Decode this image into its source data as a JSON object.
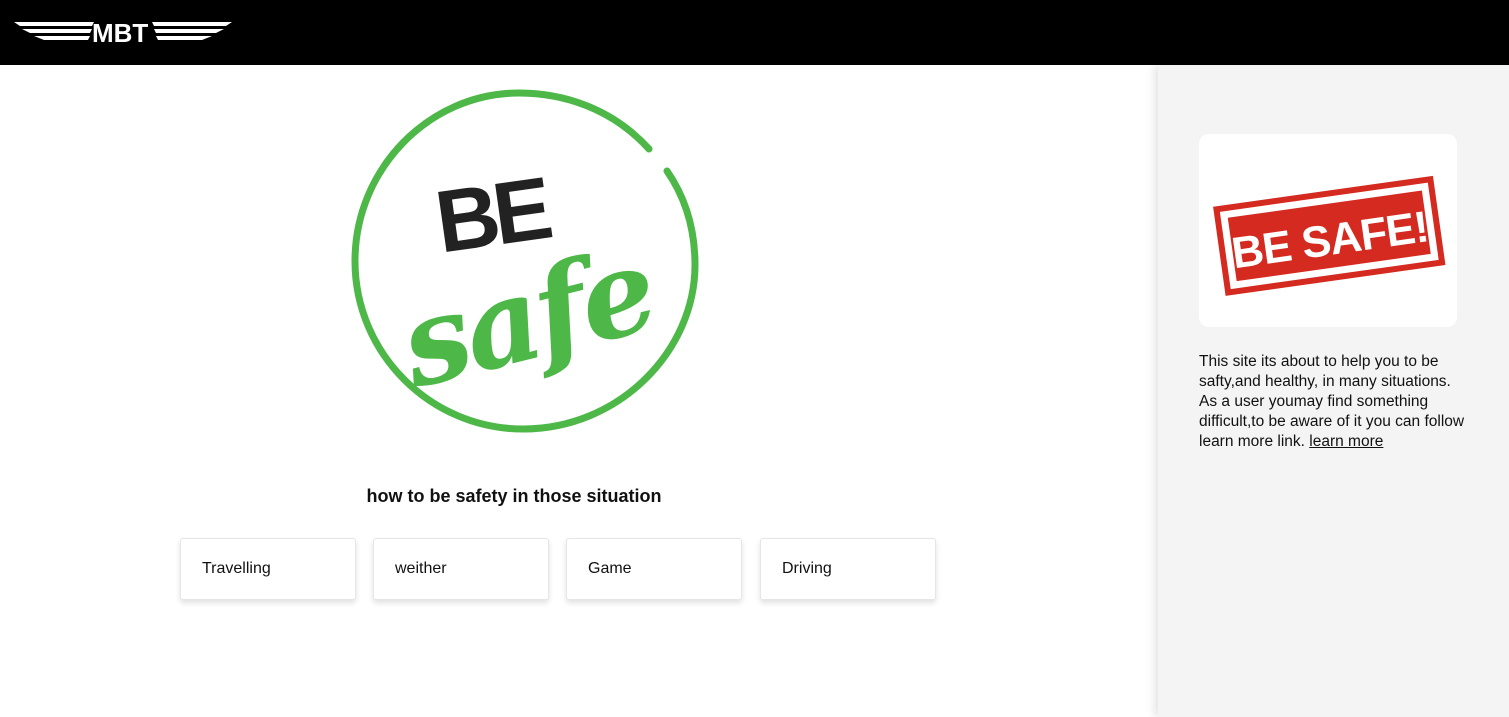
{
  "header": {
    "brand": "MBT",
    "background": "#000000"
  },
  "hero": {
    "logo_word_top": "BE",
    "logo_word_bottom": "safe",
    "logo_color": "#4db848"
  },
  "main": {
    "question": "how to be safety in those situation",
    "cards": [
      {
        "label": "Travelling"
      },
      {
        "label": "weither"
      },
      {
        "label": "Game"
      },
      {
        "label": "Driving"
      }
    ]
  },
  "sidebar": {
    "image_text": "BE SAFE!",
    "stamp_color": "#d42a20",
    "description": "This site its about to help you to be safty,and healthy, in many situations. As a user youmay find something difficult,to be aware of it you can follow learn more link.",
    "link_label": "learn more"
  }
}
